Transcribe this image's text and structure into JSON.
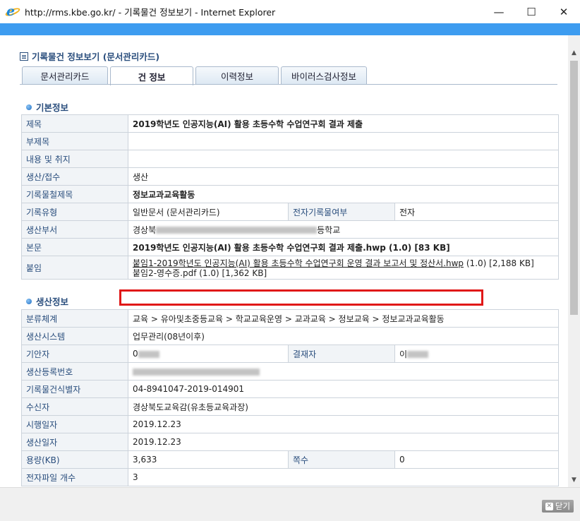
{
  "window": {
    "title": "http://rms.kbe.go.kr/ - 기록물건 정보보기 - Internet Explorer",
    "minimize": "—",
    "maximize": "☐",
    "close": "✕"
  },
  "page": {
    "title": "기록물건 정보보기 (문서관리카드)",
    "tabs": [
      {
        "label": "문서관리카드",
        "active": false
      },
      {
        "label": "건 정보",
        "active": true
      },
      {
        "label": "이력정보",
        "active": false
      },
      {
        "label": "바이러스검사정보",
        "active": false
      }
    ]
  },
  "basic": {
    "heading": "기본정보",
    "title_label": "제목",
    "title_value": "2019학년도 인공지능(AI) 활용 초등수학 수업연구회 결과 제출",
    "subtitle_label": "부제목",
    "subtitle_value": "",
    "content_label": "내용 및 취지",
    "content_value": "",
    "production_label": "생산/접수",
    "production_value": "생산",
    "filing_label": "기록물철제목",
    "filing_value": "정보교과교육활동",
    "type_label": "기록유형",
    "type_value": "일반문서 (문서관리카드)",
    "electronic_label": "전자기록물여부",
    "electronic_value": "전자",
    "dept_label": "생산부서",
    "dept_prefix": "경상북",
    "dept_suffix": "등학교",
    "body_label": "본문",
    "body_value": "2019학년도 인공지능(AI) 활용 초등수학 수업연구회 결과 제출.hwp (1.0) [83 KB]",
    "attach_label": "붙임",
    "attach1_link": "붙임1-2019학년도 인공지능(AI) 활용 초등수학 수업연구회 운영 결과 보고서 및 정산서.hwp",
    "attach1_info": "(1.0) [2,188 KB]",
    "attach2": "붙임2-영수증.pdf (1.0) [1,362 KB]"
  },
  "production": {
    "heading": "생산정보",
    "class_label": "분류체계",
    "class_value": "교육 > 유아및초중등교육 > 학교교육운영 > 교과교육 > 정보교육 > 정보교과교육활동",
    "system_label": "생산시스템",
    "system_value": "업무관리(08년이후)",
    "drafter_label": "기안자",
    "drafter_value": "0",
    "approver_label": "결재자",
    "approver_value": "이",
    "regno_label": "생산등록번호",
    "regno_value": "",
    "recid_label": "기록물건식별자",
    "recid_value": "04-8941047-2019-014901",
    "receiver_label": "수신자",
    "receiver_value": "경상북도교육감(유초등교육과장)",
    "exec_label": "시행일자",
    "exec_value": "2019.12.23",
    "prod_date_label": "생산일자",
    "prod_date_value": "2019.12.23",
    "size_label": "용량(KB)",
    "size_value": "3,633",
    "pages_label": "쪽수",
    "pages_value": "0",
    "files_label": "전자파일 개수",
    "files_value": "3"
  },
  "footer": {
    "close_label": "닫기"
  },
  "colors": {
    "accent": "#2a4e7d",
    "highlight": "#e01818",
    "strip": "#3d9cf0"
  }
}
